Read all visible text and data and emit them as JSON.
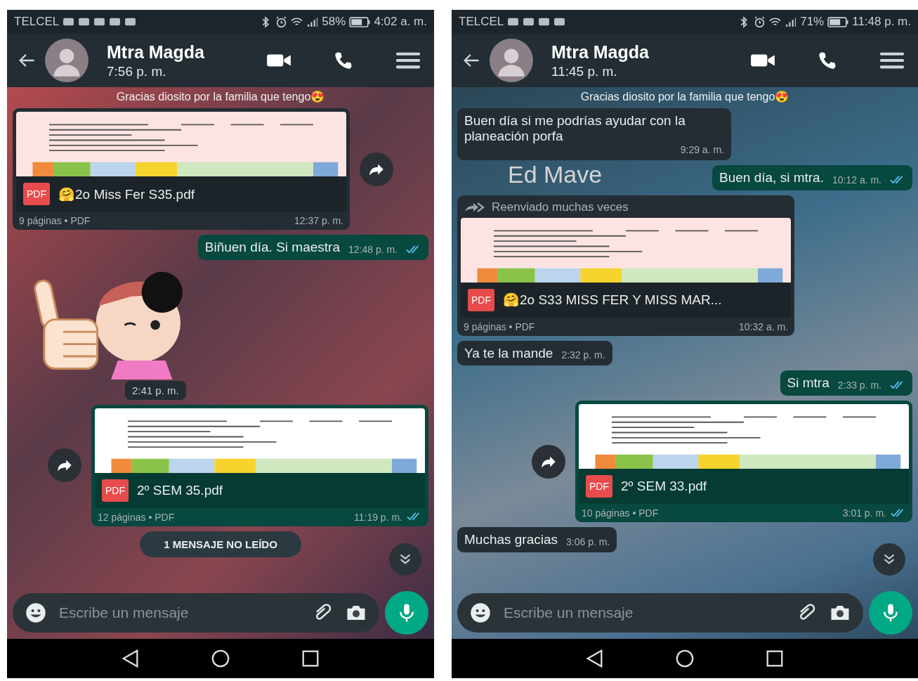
{
  "phones": [
    {
      "status_bar": {
        "carrier": "TELCEL",
        "battery": "58%",
        "time": "4:02 a. m."
      },
      "header": {
        "name": "Mtra Magda",
        "last_seen": "7:56 p. m."
      },
      "wallpaper_caption": "Gracias diosito por la familia que tengo😍",
      "messages": [
        {
          "kind": "document",
          "outgoing": false,
          "forward_button": true,
          "file_icon_text": "PDF",
          "file_name": "🤗2o Miss Fer S35.pdf",
          "meta": "9 páginas • PDF",
          "time": "12:37 p. m."
        },
        {
          "kind": "text",
          "outgoing": true,
          "text": "Biñuen día. Si maestra",
          "time": "12:48 p. m.",
          "read": true
        },
        {
          "kind": "sticker",
          "outgoing": false,
          "time": "2:41 p. m."
        },
        {
          "kind": "document",
          "outgoing": true,
          "forward_button": true,
          "file_icon_text": "PDF",
          "file_name": "2º SEM 35.pdf",
          "meta": "12 páginas • PDF",
          "time": "11:19 p. m.",
          "read": true
        }
      ],
      "unread_banner": "1 MENSAJE NO LEÍDO",
      "input": {
        "placeholder": "Escribe un mensaje"
      }
    },
    {
      "status_bar": {
        "carrier": "TELCEL",
        "battery": "71%",
        "time": "11:48 p. m."
      },
      "header": {
        "name": "Mtra Magda",
        "last_seen": "11:45 p. m."
      },
      "wallpaper_text": "Ed Mave",
      "wallpaper_caption": "Gracias diosito por la familia que tengo😍",
      "messages": [
        {
          "kind": "text",
          "outgoing": false,
          "text": "Buen día si me podrías ayudar con la planeación porfa",
          "time": "9:29 a. m."
        },
        {
          "kind": "text",
          "outgoing": true,
          "text": "Buen día, si mtra.",
          "time": "10:12 a. m.",
          "read": true
        },
        {
          "kind": "document",
          "outgoing": false,
          "forwarded": "Reenviado muchas veces",
          "file_icon_text": "PDF",
          "file_name": "🤗2o S33 MISS FER Y MISS MAR...",
          "meta": "9 páginas • PDF",
          "time": "10:32 a. m."
        },
        {
          "kind": "text",
          "outgoing": false,
          "text": "Ya te la mande",
          "time": "2:32 p. m."
        },
        {
          "kind": "text",
          "outgoing": true,
          "text": "Si mtra",
          "time": "2:33 p. m.",
          "read": true
        },
        {
          "kind": "document",
          "outgoing": true,
          "forward_button": true,
          "file_icon_text": "PDF",
          "file_name": "2º SEM 33.pdf",
          "meta": "10 páginas • PDF",
          "time": "3:01 p. m.",
          "read": true
        },
        {
          "kind": "text",
          "outgoing": false,
          "text": "Muchas gracias",
          "time": "3:06 p. m."
        }
      ],
      "input": {
        "placeholder": "Escribe un mensaje"
      }
    }
  ]
}
